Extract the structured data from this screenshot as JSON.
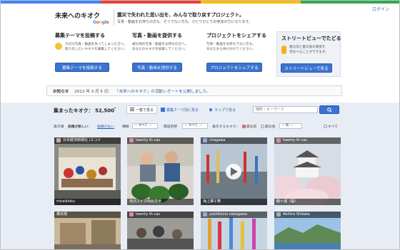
{
  "colors": {
    "topbar": [
      "#4285f4",
      "#ea4335",
      "#fbbc05",
      "#34a853"
    ],
    "accent": "#3b73d0",
    "link": "#2b5fad"
  },
  "header": {
    "login": "ログイン",
    "logo_title": "未来へのキオク",
    "logo_brand": "Google",
    "tagline": "震災で失われた思い出を、みんなで取り戻すプロジェクト。",
    "tagline_sub": "写真・動画をお持ちの方も、そうでない方も、ひとりひとりの参加が力になります。"
  },
  "promos": [
    {
      "title": "募集テーマを投稿する",
      "text1": "大切な写真・動画を失ってしまった方へ。",
      "text2": "取り戻したいキオクを募集してください。",
      "button": "募集テーマを投稿する",
      "icon": "pin-icon"
    },
    {
      "title": "写真・動画を提供する",
      "text1": "被災地の写真・動画をお持ちの方へ。",
      "text2": "あなたのキオクを投稿してください。",
      "button": "写真・動画を提供する",
      "icon": "camera-icon"
    },
    {
      "title": "プロジェクトをシェアする",
      "text1": "写真・動画をお持ちでない方も、",
      "text2": "あなたから呼びかけてください。",
      "button": "プロジェクトをシェアする",
      "icon": "share-icon"
    },
    {
      "title": "ストリートビューでたどる",
      "text1": "震災前と震災後の風景を",
      "text2": "見比べることができます。",
      "button": "ストリートビューで見る",
      "icon": "pegman-icon"
    }
  ],
  "news": {
    "label": "お知らせ",
    "date": "2012 年 3 月 5 日：",
    "link": "「未来へのキオク」の活動レポートを公開しました。"
  },
  "gallery": {
    "count_label": "集まったキオク： 52,500",
    "count_suffix": "*",
    "view_list": "一覧で見る",
    "view_theme": "募集テーマ別に見る",
    "view_map": "マップで見る",
    "search_placeholder": "場所・キーワード",
    "search_icon": "search-icon"
  },
  "filters": {
    "order_label": "表示順",
    "order_new": "投稿が新しい",
    "order_popular": "投稿が古い",
    "type_label": "種類",
    "type_value": "－ すべて －",
    "pref_label": "都道府県",
    "pref_value": "－ すべて －",
    "kioku_label": "表示するキオク：",
    "before": "震災前",
    "after": "震災後",
    "period_value": "－ 他 －",
    "all": "すべて"
  },
  "photos": [
    {
      "caption": "日本経済新聞社 /スコイ",
      "footer": "miraikioku",
      "scene": "festival-icon"
    },
    {
      "caption": "twenty th cas",
      "footer": "滝沢スイカ出荷風景",
      "scene": "watermelon-icon"
    },
    {
      "caption": "chagawa",
      "footer": "海上獅子舞",
      "scene": "video-icon"
    },
    {
      "caption": "twenty th cas",
      "footer": "鶴ヶ城（桜）",
      "scene": "castle-icon"
    },
    {
      "caption": "橋本翔",
      "footer": "",
      "scene": "street-icon"
    },
    {
      "caption": "twenty th cas",
      "footer": "",
      "scene": "crowd-icon"
    },
    {
      "caption": "yoshitomo nakagawa",
      "footer": "",
      "scene": "tanabata-icon"
    },
    {
      "caption": "Akihiro Shibata",
      "footer": "",
      "scene": "coast-icon"
    }
  ]
}
